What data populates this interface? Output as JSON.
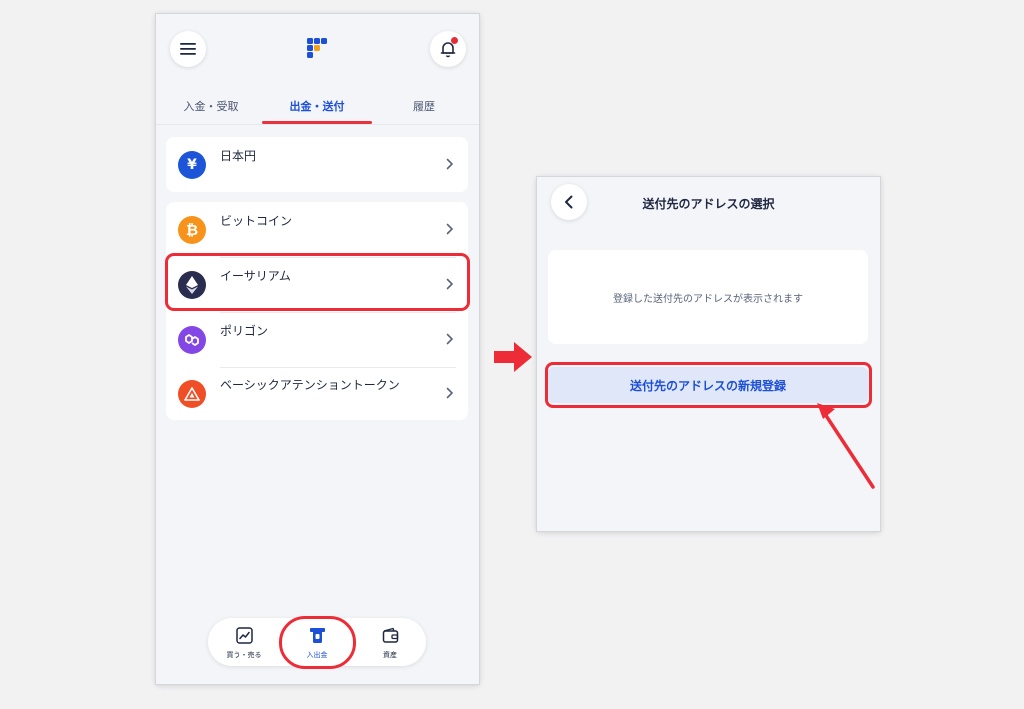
{
  "left_screen": {
    "tabs": [
      {
        "label": "入金・受取"
      },
      {
        "label": "出金・送付"
      },
      {
        "label": "履歴"
      }
    ],
    "currency_card": {
      "items": [
        {
          "label": "日本円",
          "icon": "yen-icon",
          "color": "#1c55d8"
        }
      ]
    },
    "crypto_card": {
      "items": [
        {
          "label": "ビットコイン",
          "icon": "bitcoin-icon",
          "color": "#f7931a"
        },
        {
          "label": "イーサリアム",
          "icon": "ethereum-icon",
          "color": "#2b2d4f"
        },
        {
          "label": "ポリゴン",
          "icon": "polygon-icon",
          "color": "#8247e5"
        },
        {
          "label": "ベーシックアテンショントークン",
          "icon": "bat-icon",
          "color": "#ef4e26"
        }
      ]
    },
    "bottom_nav": [
      {
        "label": "買う・売る",
        "icon": "chart-icon"
      },
      {
        "label": "入出金",
        "icon": "atm-icon"
      },
      {
        "label": "資産",
        "icon": "wallet-icon"
      }
    ]
  },
  "right_screen": {
    "title": "送付先のアドレスの選択",
    "empty_message": "登録した送付先のアドレスが表示されます",
    "register_button": "送付先のアドレスの新規登録"
  },
  "colors": {
    "accent": "#1d4fd7",
    "highlight": "#ee2c38",
    "notification_dot": "#e42d37"
  }
}
